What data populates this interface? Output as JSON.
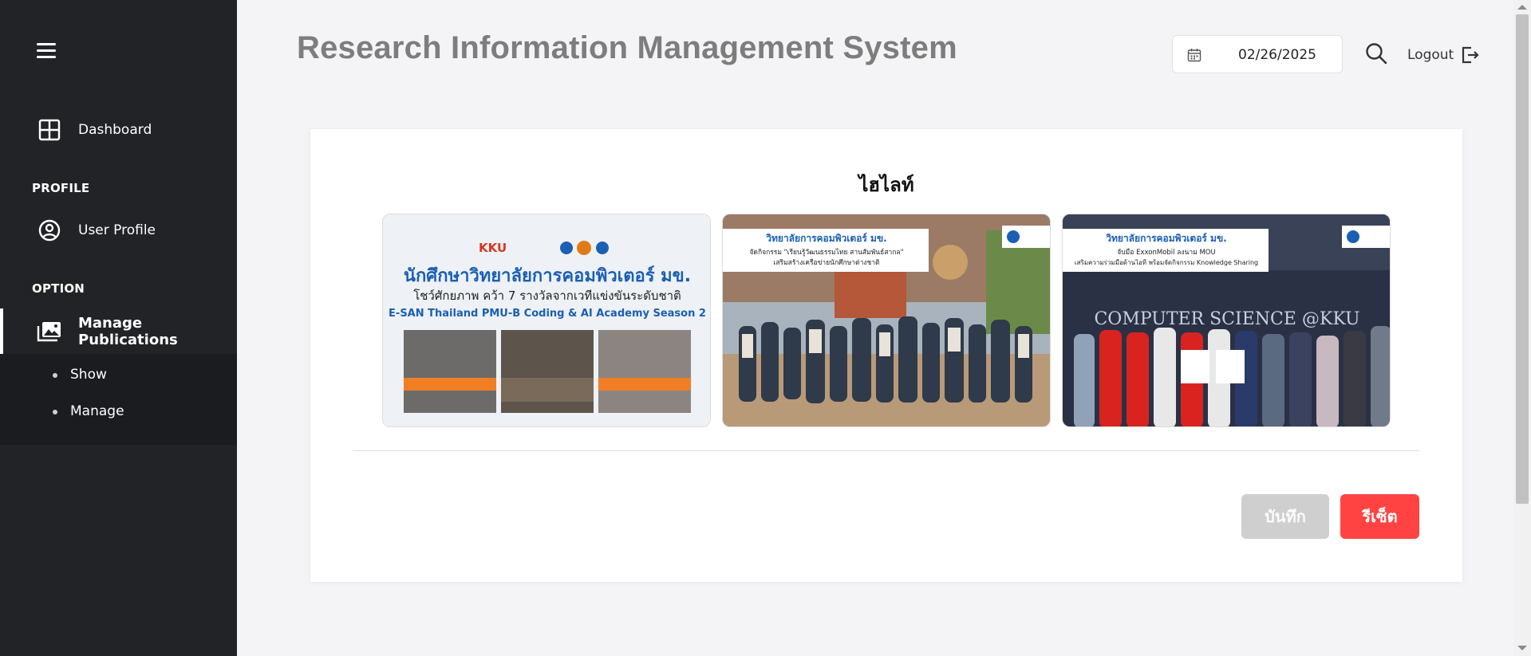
{
  "app": {
    "title": "Research Information Management System"
  },
  "header": {
    "date": "02/26/2025",
    "logout_label": "Logout"
  },
  "sidebar": {
    "dashboard_label": "Dashboard",
    "profile_section": "PROFILE",
    "user_profile_label": "User Profile",
    "option_section": "OPTION",
    "manage_publications_label": "Manage Publications",
    "submenu": {
      "show_label": "Show",
      "manage_label": "Manage"
    }
  },
  "card": {
    "title": "ไฮไลท์",
    "highlights": [
      {
        "heading": "นักศึกษาวิทยาลัยการคอมพิวเตอร์ มข.",
        "subheading": "โชว์ศักยภาพ คว้า 7 รางวัลจากเวทีแข่งขันระดับชาติ",
        "tagline": "E-SAN Thailand PMU-B Coding & AI Academy Season 2",
        "logos": "KKU"
      },
      {
        "heading": "วิทยาลัยการคอมพิวเตอร์ มข.",
        "subheading": "จัดกิจกรรม \"เรียนรู้วัฒนธรรมไทย สานสัมพันธ์สากล\"",
        "tagline": "เสริมสร้างเครือข่ายนักศึกษาต่างชาติ"
      },
      {
        "heading": "วิทยาลัยการคอมพิวเตอร์ มข.",
        "subheading": "จับมือ ExxonMobil ลงนาม MOU",
        "tagline": "เสริมความร่วมมือด้านไอที พร้อมจัดกิจกรรม Knowledge Sharing",
        "banner_text": "COMPUTER SCIENCE @KKU"
      }
    ],
    "save_label": "บันทึก",
    "reset_label": "รีเซ็ต"
  },
  "colors": {
    "sidebar": "#222327",
    "reset": "#ff4343",
    "save": "#cfcfcf",
    "accent_blue": "#1a5fb4"
  }
}
